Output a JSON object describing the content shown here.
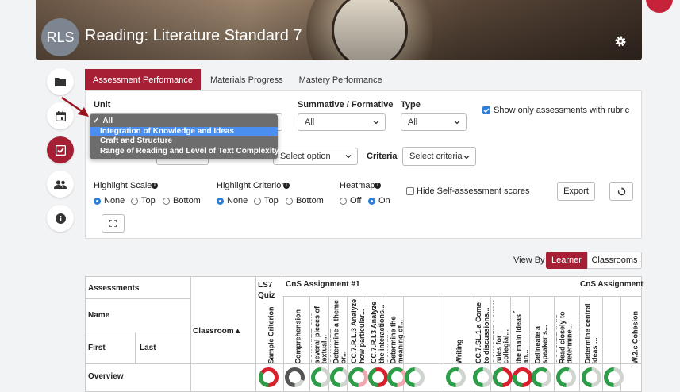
{
  "header": {
    "avatar_initials": "RLS",
    "title": "Reading: Literature Standard 7"
  },
  "tabs": [
    "Assessment Performance",
    "Materials Progress",
    "Mastery Performance"
  ],
  "filters": {
    "unit_label": "Unit",
    "unit_options": [
      "All",
      "Integration of Knowledge and Ideas",
      "Craft and Structure",
      "Range of Reading and Level of Text Complexity"
    ],
    "unit_selected": "All",
    "summative_label": "Summative / Formative",
    "summative_value": "All",
    "type_label": "Type",
    "type_value": "All",
    "rubric_only_label": "Show only assessments with rubric",
    "option_placeholder": "Select option",
    "criteria_label": "Criteria",
    "criteria_placeholder": "Select criteria"
  },
  "highlight": {
    "scales_label": "Highlight Scales",
    "criterion_label": "Highlight Criterion",
    "heatmap_label": "Heatmap",
    "none": "None",
    "top": "Top",
    "bottom": "Bottom",
    "off": "Off",
    "on": "On",
    "hide_self_label": "Hide Self-assessment scores",
    "export_label": "Export"
  },
  "view_by": {
    "label": "View By",
    "learner": "Learner",
    "classrooms": "Classrooms"
  },
  "table": {
    "assessments": "Assessments",
    "name": "Name",
    "first": "First",
    "last": "Last",
    "classroom": "Classroom▲",
    "overview": "Overview",
    "group1": "LS7 Quiz",
    "group2": "CnS Assignment #1",
    "group3": "CnS Assignment",
    "columns": [
      "Sample Criterion",
      "Comprehension",
      "CC.7.R.L.1 Cite several pieces of textual...",
      "CC.7.R.L.2 Determine a theme or...",
      "CC.7.R.L.3 Analyze how particular...",
      "CC.7.R.I.3 Analyze the interactions...",
      "CC.7.R.I.4 Determine the meaning of...",
      "Writing",
      "CC.7.SL.1.a Come to discussions...",
      "CC.7.SL.1.b Follow rules for collegial...",
      "CC.7.SL.2 Analyze the main ideas an...",
      "CC.7.SL.3 Delineate a speaker s...",
      "CCSS.ELA.R.1 Read closely to determine...",
      "CCSS.ELA.R.2 Determine central ideas ...",
      "W.2.c Cohesion"
    ]
  },
  "colors": {
    "accent": "#a61f35",
    "highlight": "#4a8ff0",
    "donut_green": "#2e9d4a",
    "donut_red": "#d9202f",
    "donut_gray": "#555555",
    "donut_light": "#cfd4cf"
  }
}
